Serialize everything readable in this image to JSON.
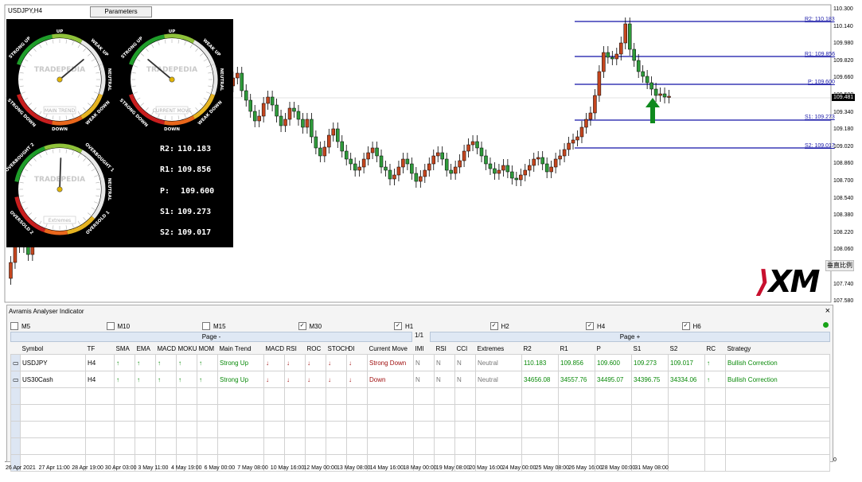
{
  "symbol": "USDJPY,H4",
  "parameters_label": "Parameters",
  "dashboard": {
    "gauges": [
      {
        "brand": "TRADEPEDIA",
        "name": "MAIN TREND",
        "top": "UP",
        "bottom": "DOWN",
        "tl": "STRONG UP",
        "tr": "WEAK UP",
        "r": "NEUTRAL",
        "bl": "STRONG DOWN",
        "br": "WEAK DOWN"
      },
      {
        "brand": "TRADEPEDIA",
        "name": "CURRENT MOVE",
        "top": "UP",
        "bottom": "DOWN",
        "tl": "STRONG UP",
        "tr": "WEAK UP",
        "r": "NEUTRAL",
        "bl": "STRONG DOWN",
        "br": "WEAK DOWN"
      },
      {
        "brand": "TRADEPEDIA",
        "name": "Extremes",
        "tl": "OVERBOUGHT 2",
        "tr": "OVERBOUGHT 1",
        "r": "NEUTRAL",
        "bl": "OVERSOLD 2",
        "br": "OVERSOLD 1"
      }
    ],
    "levels": [
      {
        "label": "R2:",
        "value": "110.183"
      },
      {
        "label": "R1:",
        "value": "109.856"
      },
      {
        "label": "P:",
        "value": "109.600"
      },
      {
        "label": "S1:",
        "value": "109.273"
      },
      {
        "label": "S2:",
        "value": "109.017"
      }
    ]
  },
  "price_axis": [
    "110.300",
    "110.140",
    "109.980",
    "109.820",
    "109.660",
    "109.500",
    "109.340",
    "109.180",
    "109.020",
    "108.860",
    "108.700",
    "108.540",
    "108.380",
    "108.220",
    "108.060",
    "107.900",
    "107.740",
    "107.580"
  ],
  "current_price": "109.481",
  "level_labels": [
    "R2: 110.183",
    "R1: 109.856",
    "P: 109.600",
    "S1: 109.273",
    "S2: 109.017"
  ],
  "scale_button": "垂直比例",
  "brand": "XM",
  "panel": {
    "title": "Avramis Analyser Indicator",
    "close": "×",
    "timeframes": [
      {
        "label": "M5",
        "checked": false
      },
      {
        "label": "M10",
        "checked": false
      },
      {
        "label": "M15",
        "checked": false
      },
      {
        "label": "M30",
        "checked": true
      },
      {
        "label": "H1",
        "checked": true
      },
      {
        "label": "H2",
        "checked": true
      },
      {
        "label": "H4",
        "checked": true
      },
      {
        "label": "H6",
        "checked": true
      }
    ],
    "page_minus": "Page -",
    "page_plus": "Page +",
    "page_indicator": "1/1",
    "headers": [
      "Symbol",
      "TF",
      "SMA",
      "EMA",
      "MACD",
      "MOKU",
      "MOM",
      "Main Trend",
      "MACD",
      "RSI",
      "ROC",
      "STOCH",
      "DI",
      "Current Move",
      "IMI",
      "RSI",
      "CCI",
      "Extremes",
      "R2",
      "R1",
      "P",
      "S1",
      "S2",
      "RC",
      "Strategy"
    ],
    "rows": [
      {
        "symbol": "USDJPY",
        "tf": "H4",
        "main": "Strong Up",
        "cur": "Strong Down",
        "imi": "N",
        "rsi": "N",
        "cci": "N",
        "ext": "Neutral",
        "r2": "110.183",
        "r1": "109.856",
        "p": "109.600",
        "s1": "109.273",
        "s2": "109.017",
        "strategy": "Bullish Correction"
      },
      {
        "symbol": "US30Cash",
        "tf": "H4",
        "main": "Strong Up",
        "cur": "Down",
        "imi": "N",
        "rsi": "N",
        "cci": "N",
        "ext": "Neutral",
        "r2": "34656.08",
        "r1": "34557.76",
        "p": "34495.07",
        "s1": "34396.75",
        "s2": "34334.06",
        "strategy": "Bullish Correction"
      }
    ],
    "zero": "0"
  },
  "time_axis": [
    "26 Apr 2021",
    "27 Apr 11:00",
    "28 Apr 19:00",
    "30 Apr 03:00",
    "3 May 11:00",
    "4 May 19:00",
    "6 May 00:00",
    "7 May 08:00",
    "10 May 16:00",
    "12 May 00:00",
    "13 May 08:00",
    "14 May 16:00",
    "18 May 00:00",
    "19 May 08:00",
    "20 May 16:00",
    "24 May 00:00",
    "25 May 08:00",
    "26 May 16:00",
    "28 May 00:00",
    "31 May 08:00"
  ]
}
